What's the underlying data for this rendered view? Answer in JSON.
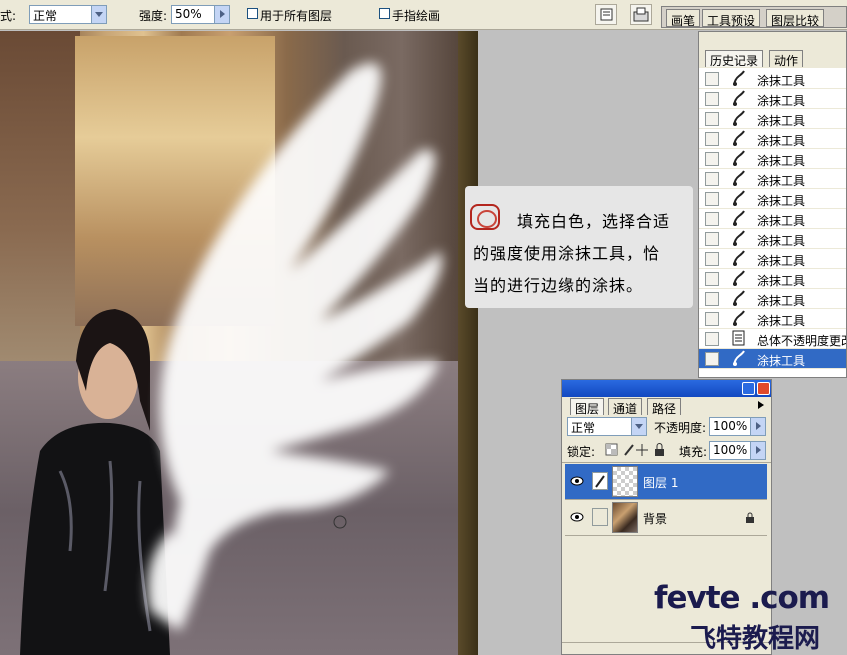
{
  "options_bar": {
    "mode_label_fragment": "式:",
    "mode_value": "正常",
    "strength_label": "强度:",
    "strength_value": "50%",
    "all_layers_label": "用于所有图层",
    "finger_paint_label": "手指绘画",
    "well_tabs": [
      "画笔",
      "工具预设",
      "图层比较"
    ]
  },
  "caption": {
    "lines": [
      "填充白色，选择合适",
      "的强度使用涂抹工具，恰",
      "当的进行边缘的涂抹。"
    ]
  },
  "history_panel": {
    "tabs": [
      "历史记录",
      "动作"
    ],
    "items": [
      {
        "label": "涂抹工具",
        "icon": "smudge-icon",
        "selected": false
      },
      {
        "label": "涂抹工具",
        "icon": "smudge-icon",
        "selected": false
      },
      {
        "label": "涂抹工具",
        "icon": "smudge-icon",
        "selected": false
      },
      {
        "label": "涂抹工具",
        "icon": "smudge-icon",
        "selected": false
      },
      {
        "label": "涂抹工具",
        "icon": "smudge-icon",
        "selected": false
      },
      {
        "label": "涂抹工具",
        "icon": "smudge-icon",
        "selected": false
      },
      {
        "label": "涂抹工具",
        "icon": "smudge-icon",
        "selected": false
      },
      {
        "label": "涂抹工具",
        "icon": "smudge-icon",
        "selected": false
      },
      {
        "label": "涂抹工具",
        "icon": "smudge-icon",
        "selected": false
      },
      {
        "label": "涂抹工具",
        "icon": "smudge-icon",
        "selected": false
      },
      {
        "label": "涂抹工具",
        "icon": "smudge-icon",
        "selected": false
      },
      {
        "label": "涂抹工具",
        "icon": "smudge-icon",
        "selected": false
      },
      {
        "label": "涂抹工具",
        "icon": "smudge-icon",
        "selected": false
      },
      {
        "label": "总体不透明度更改",
        "icon": "document-icon",
        "selected": false
      },
      {
        "label": "涂抹工具",
        "icon": "smudge-icon",
        "selected": true
      }
    ]
  },
  "layers_panel": {
    "tabs": [
      "图层",
      "通道",
      "路径"
    ],
    "blend_mode": "正常",
    "opacity_label": "不透明度:",
    "opacity_value": "100%",
    "lock_label": "锁定:",
    "fill_label": "填充:",
    "fill_value": "100%",
    "layers": [
      {
        "name": "图层 1",
        "selected": true,
        "locked": false
      },
      {
        "name": "背景",
        "selected": false,
        "locked": true
      }
    ]
  },
  "watermark": {
    "line1": "fevte .com",
    "line2": "飞特教程网"
  },
  "colors": {
    "selection": "#316ac5",
    "panel_bg": "#ece9d8",
    "titlebar": "#1248c0",
    "seal_red": "#b3261e"
  }
}
